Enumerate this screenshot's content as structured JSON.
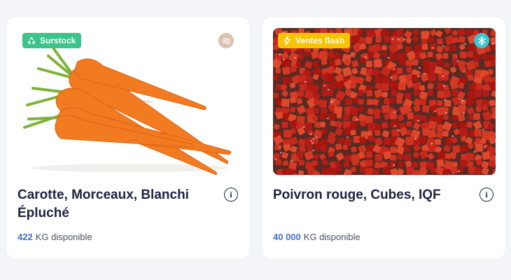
{
  "products": [
    {
      "badge": {
        "label": "Surstock",
        "icon": "recycle-icon",
        "color": "#3cc48a"
      },
      "corner": {
        "icon": "waves-icon",
        "color": "#d9c2ae"
      },
      "image": "carrot-photo",
      "title": "Carotte, Morceaux, Blanchi Épluché",
      "qty_value": "422",
      "qty_unit": "KG disponible"
    },
    {
      "badge": {
        "label": "Ventes flash",
        "icon": "lightning-icon",
        "color": "#f7c300"
      },
      "corner": {
        "icon": "snowflake-icon",
        "color": "#3dc6d2"
      },
      "image": "diced-red-pepper-photo",
      "title": "Poivron rouge, Cubes, IQF",
      "qty_value": "40 000",
      "qty_unit": "KG disponible"
    }
  ],
  "info_glyph": "i"
}
